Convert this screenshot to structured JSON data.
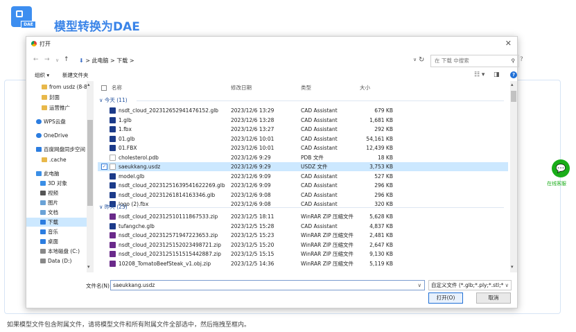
{
  "header": {
    "badge": "DAE",
    "title": "模型转换为DAE"
  },
  "hint": "如果模型文件包含附属文件，请将模型文件和所有附属文件全部选中，然后拖拽至框内。",
  "wechat": {
    "label": "在线客服"
  },
  "dialog": {
    "title": "打开",
    "close": "✕",
    "path": [
      "此电脑",
      "下载"
    ],
    "search_placeholder": "在 下载 中搜索",
    "toolbar": {
      "organize": "组织 ▾",
      "new_folder": "新建文件夹"
    },
    "sidebar": [
      {
        "label": "from usdz  (8-8 ^",
        "color": "#e8b84a"
      },
      {
        "label": "封面",
        "color": "#e8b84a"
      },
      {
        "label": "运营推广",
        "color": "#e8b84a"
      },
      {
        "label": "WPS云盘",
        "color": "#2c7de0"
      },
      {
        "label": "OneDrive",
        "color": "#2c7de0"
      },
      {
        "label": "百度网盘同步空间",
        "color": "#2c7de0"
      },
      {
        "label": ".cache",
        "color": "#e8b84a"
      },
      {
        "label": "此电脑",
        "color": "#3a8ee6"
      },
      {
        "label": "3D 对象",
        "color": "#3a8ee6"
      },
      {
        "label": "视频",
        "color": "#555"
      },
      {
        "label": "图片",
        "color": "#6aa2d6"
      },
      {
        "label": "文档",
        "color": "#6aa2d6"
      },
      {
        "label": "下载",
        "color": "#2c7de0",
        "selected": true
      },
      {
        "label": "音乐",
        "color": "#2c7de0"
      },
      {
        "label": "桌面",
        "color": "#2c7de0"
      },
      {
        "label": "本地磁盘 (C:)",
        "color": "#888"
      },
      {
        "label": "Data (D:)",
        "color": "#888"
      }
    ],
    "columns": {
      "name": "名称",
      "date": "修改日期",
      "type": "类型",
      "size": "大小"
    },
    "groups": {
      "today": "今天 (11)",
      "yesterday": "昨天 (25)"
    },
    "files_today": [
      {
        "name": "nsdt_cloud_202312652941476152.glb",
        "date": "2023/12/6 13:29",
        "type": "CAD Assistant",
        "size": "679 KB",
        "color": "#1c3b8a"
      },
      {
        "name": "1.glb",
        "date": "2023/12/6 13:28",
        "type": "CAD Assistant",
        "size": "1,681 KB",
        "color": "#1c3b8a"
      },
      {
        "name": "1.fbx",
        "date": "2023/12/6 13:27",
        "type": "CAD Assistant",
        "size": "292 KB",
        "color": "#1c3b8a"
      },
      {
        "name": "01.glb",
        "date": "2023/12/6 10:01",
        "type": "CAD Assistant",
        "size": "54,161 KB",
        "color": "#1c3b8a"
      },
      {
        "name": "01.FBX",
        "date": "2023/12/6 10:01",
        "type": "CAD Assistant",
        "size": "12,439 KB",
        "color": "#1c3b8a"
      },
      {
        "name": "cholesterol.pdb",
        "date": "2023/12/6 9:29",
        "type": "PDB 文件",
        "size": "18 KB",
        "color": "#ffffff"
      },
      {
        "name": "saeukkang.usdz",
        "date": "2023/12/6 9:29",
        "type": "USDZ 文件",
        "size": "3,753 KB",
        "color": "#ffffff",
        "selected": true
      },
      {
        "name": "model.glb",
        "date": "2023/12/6 9:09",
        "type": "CAD Assistant",
        "size": "527 KB",
        "color": "#1c3b8a"
      },
      {
        "name": "nsdt_cloud_20231251639541622269.glb",
        "date": "2023/12/6 9:09",
        "type": "CAD Assistant",
        "size": "296 KB",
        "color": "#1c3b8a"
      },
      {
        "name": "nsdt_cloud_20231261814163346.glb",
        "date": "2023/12/6 9:08",
        "type": "CAD Assistant",
        "size": "296 KB",
        "color": "#1c3b8a"
      },
      {
        "name": "logo (2).fbx",
        "date": "2023/12/6 9:08",
        "type": "CAD Assistant",
        "size": "320 KB",
        "color": "#1c3b8a"
      }
    ],
    "files_yesterday": [
      {
        "name": "nsdt_cloud_20231251011186753​3.zip",
        "date": "2023/12/5 18:11",
        "type": "WinRAR ZIP 压缩文件",
        "size": "5,628 KB",
        "color": "#6a2a8a"
      },
      {
        "name": "tufangche.glb",
        "date": "2023/12/5 15:28",
        "type": "CAD Assistant",
        "size": "4,837 KB",
        "color": "#1c3b8a"
      },
      {
        "name": "nsdt_cloud_20231257194722​3653.zip",
        "date": "2023/12/5 15:23",
        "type": "WinRAR ZIP 压缩文件",
        "size": "2,481 KB",
        "color": "#6a2a8a"
      },
      {
        "name": "nsdt_cloud_202312515202349872​1.zip",
        "date": "2023/12/5 15:20",
        "type": "WinRAR ZIP 压缩文件",
        "size": "2,647 KB",
        "color": "#6a2a8a"
      },
      {
        "name": "nsdt_cloud_2023125151515442887.zip",
        "date": "2023/12/5 15:15",
        "type": "WinRAR ZIP 压缩文件",
        "size": "9,130 KB",
        "color": "#6a2a8a"
      },
      {
        "name": "10208_TomatoBeefSteak_v1.obj.zip",
        "date": "2023/12/5 14:36",
        "type": "WinRAR ZIP 压缩文件",
        "size": "5,119 KB",
        "color": "#6a2a8a"
      }
    ],
    "filename_label": "文件名(N):",
    "filename_value": "saeukkang.usdz",
    "filetype": "自定义文件 (*.glb;*.ply;*.stl;*.o",
    "open_label": "打开(O)",
    "cancel_label": "取消"
  }
}
